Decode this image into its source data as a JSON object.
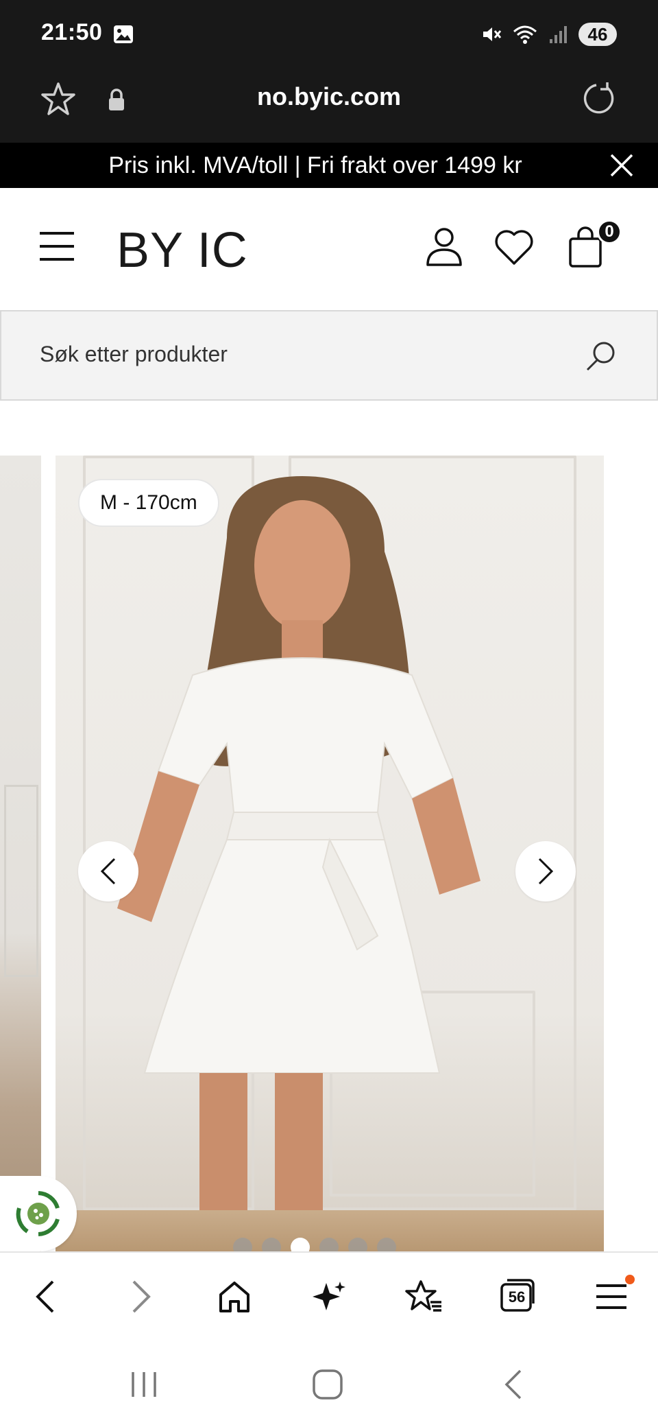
{
  "status_bar": {
    "time": "21:50",
    "battery": "46"
  },
  "browser": {
    "url": "no.byic.com",
    "tab_count": "56"
  },
  "promo": {
    "text": "Pris inkl. MVA/toll | Fri frakt over 1499 kr"
  },
  "header": {
    "logo": "BY IC",
    "cart_count": "0"
  },
  "search": {
    "placeholder": "Søk etter produkter"
  },
  "gallery": {
    "size_badge": "M - 170cm",
    "dots_total": 6,
    "active_dot": 3
  },
  "colors": {
    "status_bg": "#181818",
    "promo_bg": "#000000",
    "accent_dot": "#f05a1a",
    "eco_green": "#2e7d32"
  }
}
